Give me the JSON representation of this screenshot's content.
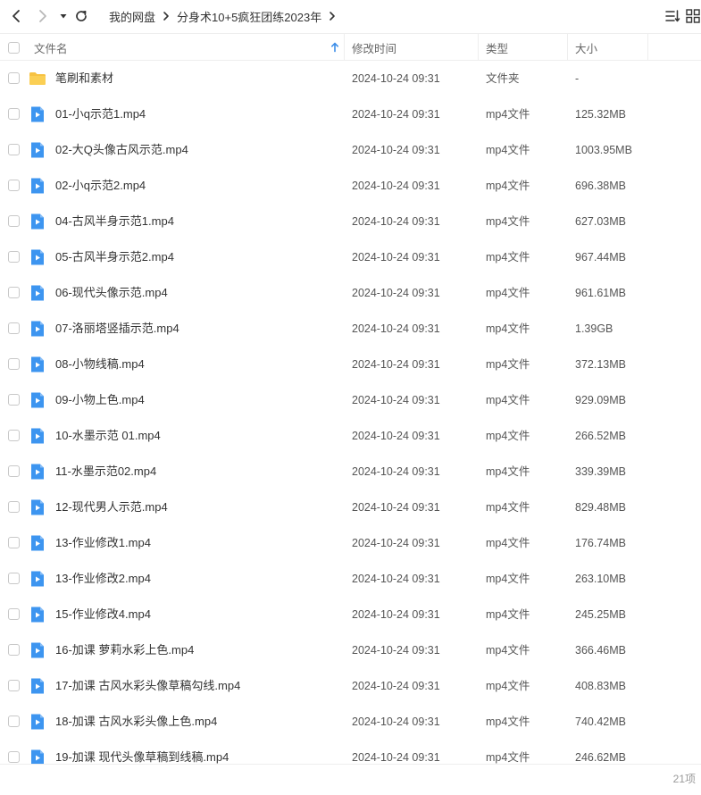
{
  "toolbar": {
    "back_icon": "chevron-left-icon",
    "forward_icon": "chevron-right-icon",
    "dropdown_icon": "caret-down-icon",
    "refresh_icon": "refresh-icon",
    "breadcrumbs": [
      "我的网盘",
      "分身术10+5疯狂团练2023年"
    ],
    "sort_icon": "sort-list-icon",
    "grid_icon": "grid-view-icon"
  },
  "columns": {
    "name": "文件名",
    "modified": "修改时间",
    "type": "类型",
    "size": "大小",
    "sort_indicator_icon": "sort-up-arrow-icon"
  },
  "colors": {
    "accent": "#3b8de8",
    "folder": "#f7c242",
    "video": "#3d95f0"
  },
  "files": [
    {
      "name": "笔刷和素材",
      "modified": "2024-10-24 09:31",
      "type": "文件夹",
      "size": "-",
      "kind": "folder"
    },
    {
      "name": "01-小q示范1.mp4",
      "modified": "2024-10-24 09:31",
      "type": "mp4文件",
      "size": "125.32MB",
      "kind": "video"
    },
    {
      "name": "02-大Q头像古风示范.mp4",
      "modified": "2024-10-24 09:31",
      "type": "mp4文件",
      "size": "1003.95MB",
      "kind": "video"
    },
    {
      "name": "02-小q示范2.mp4",
      "modified": "2024-10-24 09:31",
      "type": "mp4文件",
      "size": "696.38MB",
      "kind": "video"
    },
    {
      "name": "04-古风半身示范1.mp4",
      "modified": "2024-10-24 09:31",
      "type": "mp4文件",
      "size": "627.03MB",
      "kind": "video"
    },
    {
      "name": "05-古风半身示范2.mp4",
      "modified": "2024-10-24 09:31",
      "type": "mp4文件",
      "size": "967.44MB",
      "kind": "video"
    },
    {
      "name": "06-现代头像示范.mp4",
      "modified": "2024-10-24 09:31",
      "type": "mp4文件",
      "size": "961.61MB",
      "kind": "video"
    },
    {
      "name": "07-洛丽塔竖插示范.mp4",
      "modified": "2024-10-24 09:31",
      "type": "mp4文件",
      "size": "1.39GB",
      "kind": "video"
    },
    {
      "name": "08-小物线稿.mp4",
      "modified": "2024-10-24 09:31",
      "type": "mp4文件",
      "size": "372.13MB",
      "kind": "video"
    },
    {
      "name": "09-小物上色.mp4",
      "modified": "2024-10-24 09:31",
      "type": "mp4文件",
      "size": "929.09MB",
      "kind": "video"
    },
    {
      "name": "10-水墨示范 01.mp4",
      "modified": "2024-10-24 09:31",
      "type": "mp4文件",
      "size": "266.52MB",
      "kind": "video"
    },
    {
      "name": "11-水墨示范02.mp4",
      "modified": "2024-10-24 09:31",
      "type": "mp4文件",
      "size": "339.39MB",
      "kind": "video"
    },
    {
      "name": "12-现代男人示范.mp4",
      "modified": "2024-10-24 09:31",
      "type": "mp4文件",
      "size": "829.48MB",
      "kind": "video"
    },
    {
      "name": "13-作业修改1.mp4",
      "modified": "2024-10-24 09:31",
      "type": "mp4文件",
      "size": "176.74MB",
      "kind": "video"
    },
    {
      "name": "13-作业修改2.mp4",
      "modified": "2024-10-24 09:31",
      "type": "mp4文件",
      "size": "263.10MB",
      "kind": "video"
    },
    {
      "name": "15-作业修改4.mp4",
      "modified": "2024-10-24 09:31",
      "type": "mp4文件",
      "size": "245.25MB",
      "kind": "video"
    },
    {
      "name": "16-加课 萝莉水彩上色.mp4",
      "modified": "2024-10-24 09:31",
      "type": "mp4文件",
      "size": "366.46MB",
      "kind": "video"
    },
    {
      "name": "17-加课 古风水彩头像草稿勾线.mp4",
      "modified": "2024-10-24 09:31",
      "type": "mp4文件",
      "size": "408.83MB",
      "kind": "video"
    },
    {
      "name": "18-加课 古风水彩头像上色.mp4",
      "modified": "2024-10-24 09:31",
      "type": "mp4文件",
      "size": "740.42MB",
      "kind": "video"
    },
    {
      "name": "19-加课 现代头像草稿到线稿.mp4",
      "modified": "2024-10-24 09:31",
      "type": "mp4文件",
      "size": "246.62MB",
      "kind": "video"
    }
  ],
  "footer": {
    "count": "21项"
  }
}
